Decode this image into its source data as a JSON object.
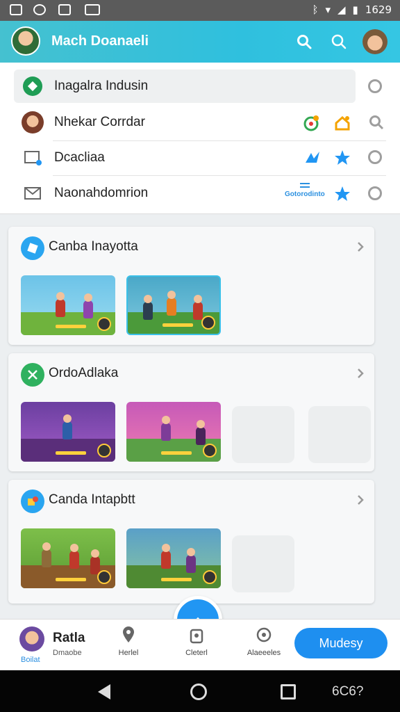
{
  "status_bar": {
    "time": "1629"
  },
  "app_bar": {
    "title": "Mach Doanaeli"
  },
  "list": [
    {
      "label": "Inagalra Indusin",
      "icon": "green-diamond-icon"
    },
    {
      "label": "Nhekar Corrdar",
      "icon": "avatar-icon"
    },
    {
      "label": "Dcacliaa",
      "icon": "window-icon"
    },
    {
      "label": "Naonahdomrion",
      "icon": "mail-icon",
      "trail_text": "Gotorodinto"
    }
  ],
  "sections": [
    {
      "title": "Canba Inayotta",
      "icon": "blue-box-icon"
    },
    {
      "title": "OrdoAdlaka",
      "icon": "green-cross-icon"
    },
    {
      "title": "Canda Intapbtt",
      "icon": "puzzle-icon"
    }
  ],
  "bottom_nav": {
    "user_name": "Ratla",
    "user_sub": "Dmaobe",
    "user_tag": "Boilat",
    "items": [
      "Herlel",
      "Cleterl",
      "Alaeeeles"
    ],
    "cta": "Mudesy"
  },
  "system_nav": {
    "text": "6C6?"
  },
  "colors": {
    "accent": "#2fc0de",
    "primary": "#1e8ff0",
    "cta": "#1e8ff0"
  }
}
